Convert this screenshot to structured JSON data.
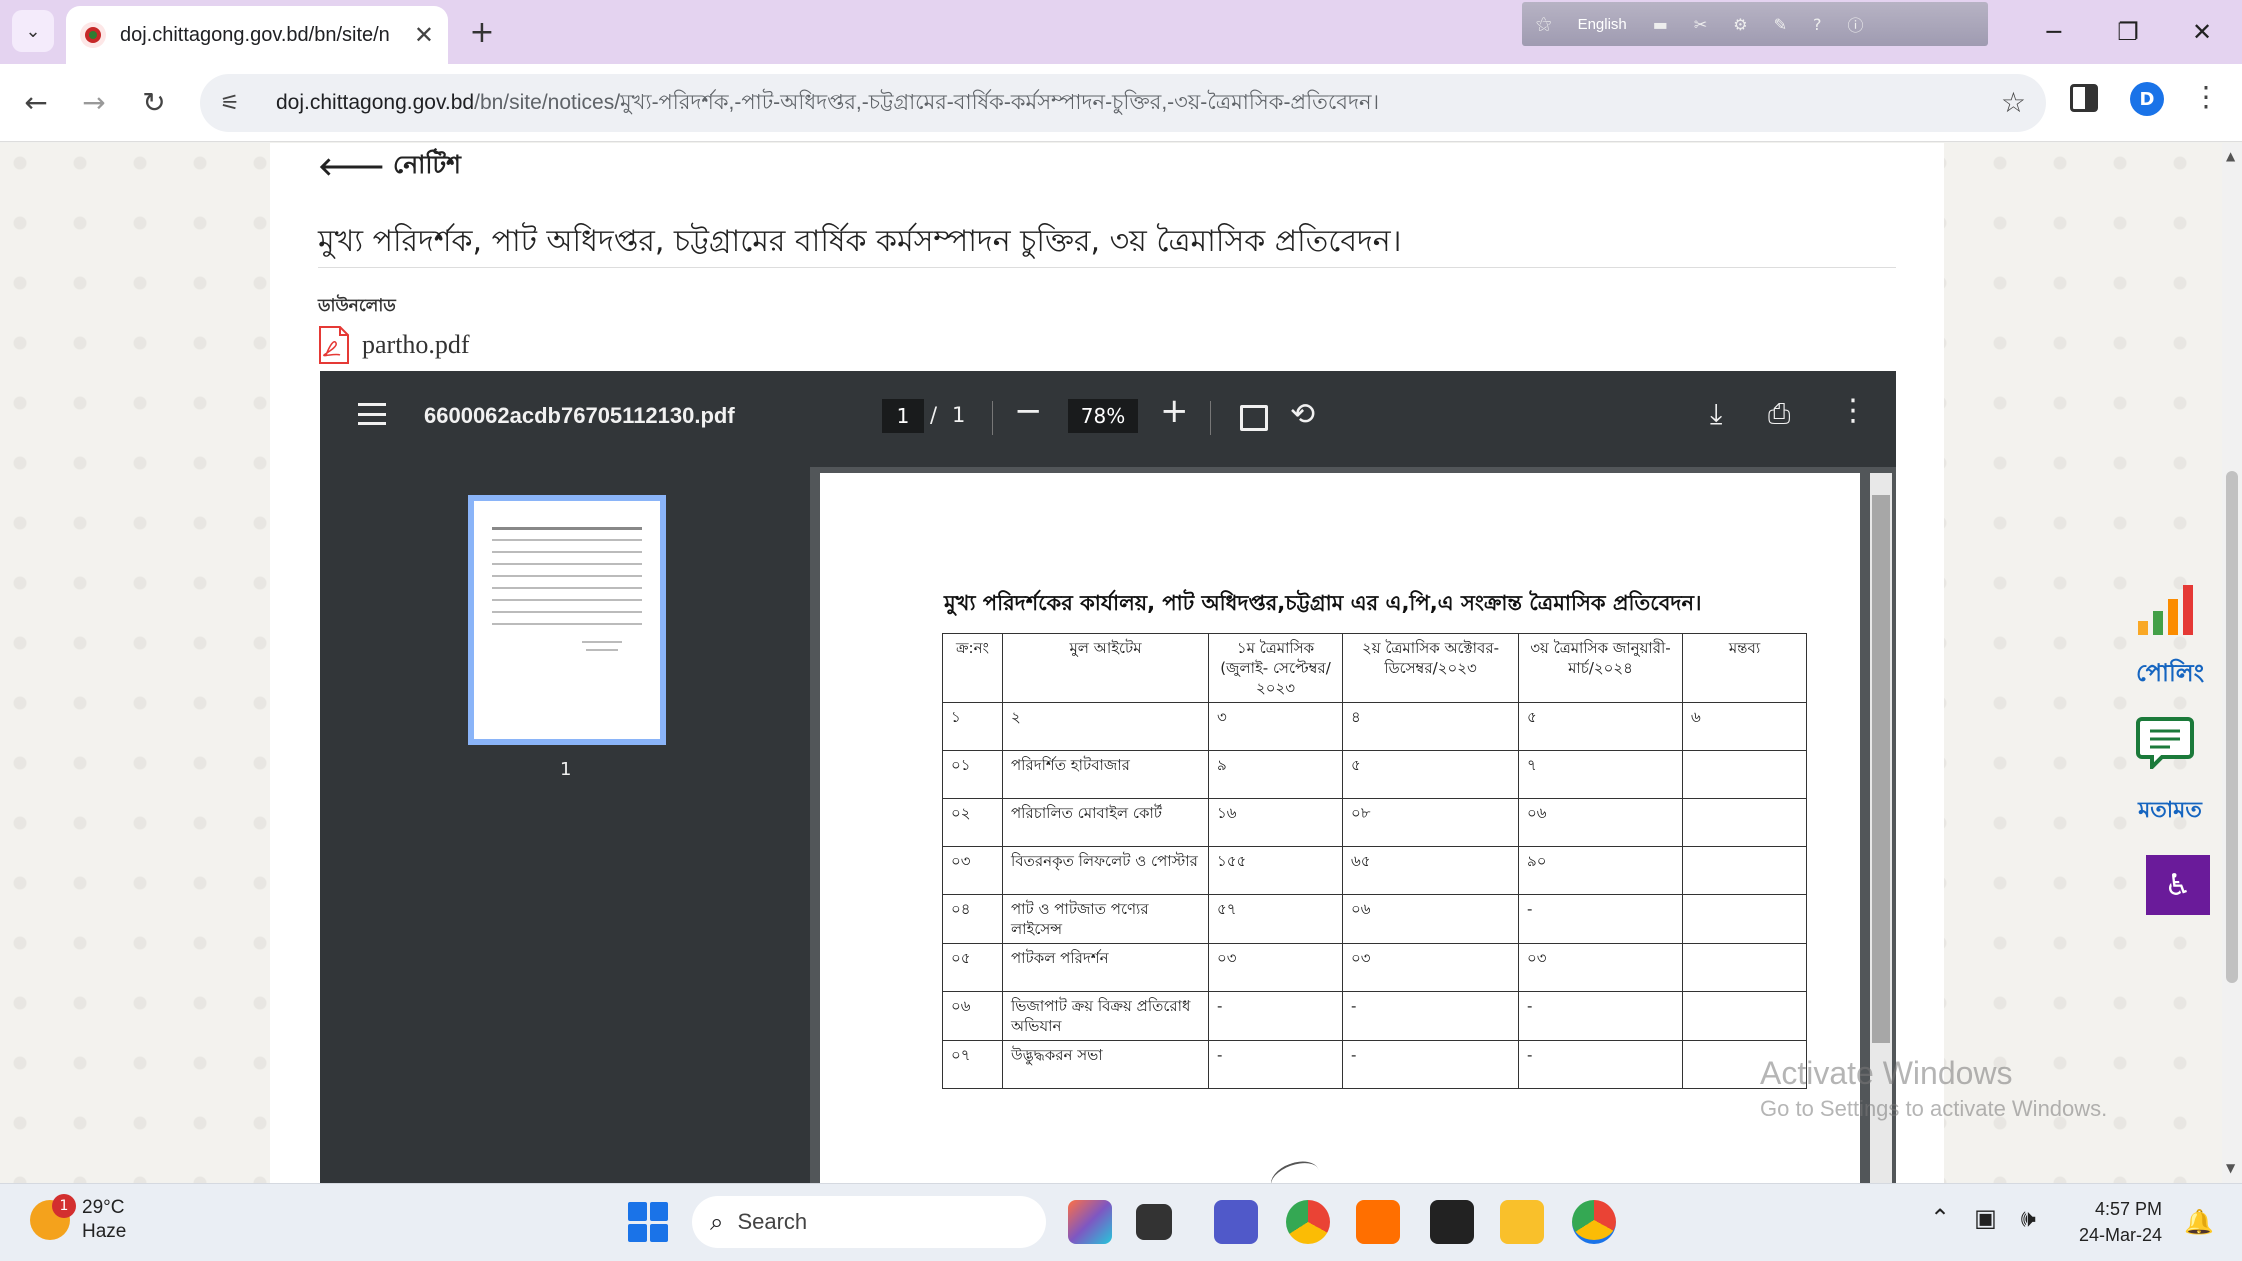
{
  "browser": {
    "tab_title": "doj.chittagong.gov.bd/bn/site/n",
    "tab_close": "✕",
    "new_tab": "+",
    "ime_language": "English",
    "url_host": "doj.chittagong.gov.bd",
    "url_path": "/bn/site/notices/মুখ্য-পরিদর্শক,-পাট-অধিদপ্তর,-চট্টগ্রামের-বার্ষিক-কর্মসম্পাদন-চুক্তির,-৩য়-ত্রৈমাসিক-প্রতিবেদন।",
    "profile_initial": "D"
  },
  "page": {
    "back_label": "নোটিশ",
    "title": "মুখ্য পরিদর্শক, পাট অধিদপ্তর, চট্টগ্রামের বার্ষিক কর্মসম্পাদন চুক্তির, ৩য় ত্রৈমাসিক প্রতিবেদন।",
    "download_label": "ডাউনলোড",
    "attachment_name": "partho.pdf"
  },
  "pdf_viewer": {
    "filename": "6600062acdb76705112130.pdf",
    "current_page": "1",
    "page_separator": "/",
    "total_pages": "1",
    "zoom": "78%",
    "thumbnail_label": "1"
  },
  "document": {
    "heading": "মুখ্য পরিদর্শকের কার্যালয়, পাট অধিদপ্তর,চট্টগ্রাম এর এ,পি,এ সংক্রান্ত ত্রৈমাসিক প্রতিবেদন।",
    "headers": [
      "ক্র:নং",
      "মুল আইটেম",
      "১ম ত্রৈমাসিক (জুলাই- সেপ্টেম্বর/২০২৩",
      "২য় ত্রৈমাসিক অক্টোবর-ডিসেম্বর/২০২৩",
      "৩য় ত্রৈমাসিক জানুয়ারী-মার্চ/২০২৪",
      "মন্তব্য"
    ],
    "rows": [
      [
        "১",
        "২",
        "৩",
        "৪",
        "৫",
        "৬"
      ],
      [
        "০১",
        "পরিদর্শিত হাটবাজার",
        "৯",
        "৫",
        "৭",
        ""
      ],
      [
        "০২",
        "পরিচালিত মোবাইল কোর্ট",
        "১৬",
        "০৮",
        "০৬",
        ""
      ],
      [
        "০৩",
        "বিতরনকৃত লিফলেট ও পোস্টার",
        "১৫৫",
        "৬৫",
        "৯০",
        ""
      ],
      [
        "০৪",
        "পাট ও পাটজাত পণ্যের লাইসেন্স",
        "৫৭",
        "০৬",
        "-",
        ""
      ],
      [
        "০৫",
        "পাটকল পরিদর্শন",
        "০৩",
        "০৩",
        "০৩",
        ""
      ],
      [
        "০৬",
        "ভিজাপাট ক্রয় বিক্রয় প্রতিরোধ অভিযান",
        "-",
        "-",
        "-",
        ""
      ],
      [
        "০৭",
        "উদ্ভুদ্ধকরন সভা",
        "-",
        "-",
        "-",
        ""
      ]
    ]
  },
  "widgets": {
    "poll_label": "পোলিং",
    "opinion_label": "মতামত"
  },
  "watermark": {
    "line1": "Activate Windows",
    "line2": "Go to Settings to activate Windows."
  },
  "taskbar": {
    "temperature": "29°C",
    "condition": "Haze",
    "weather_badge": "1",
    "search_placeholder": "Search",
    "time": "4:57 PM",
    "date": "24-Mar-24"
  },
  "colors": {
    "tabstrip": "#e4d3f0",
    "pdf_toolbar": "#323639",
    "widget_label": "#1565c0",
    "accessibility": "#6a1b9a"
  }
}
